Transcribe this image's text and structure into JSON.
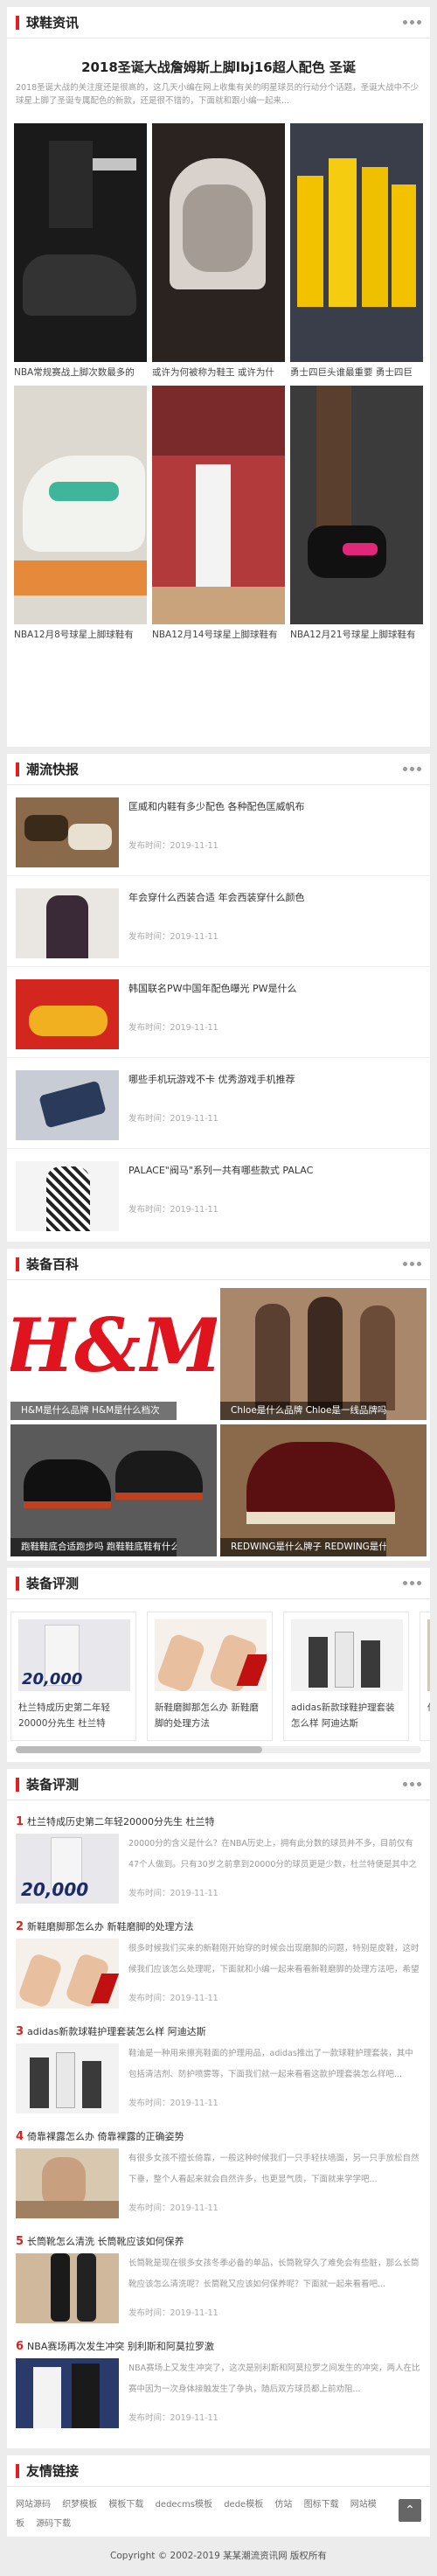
{
  "section1": {
    "title": "球鞋资讯",
    "headline": "2018圣诞大战詹姆斯上脚lbj16超人配色 圣诞",
    "lead": "2018圣诞大战的关注度还是很高的，这几天小编在网上收集有关的明星球员的行动分个话题，圣诞大战中不少球星上脚了圣诞专属配色的新款，还是很不错的，下面就和跟小编一起来...",
    "items": [
      {
        "caption": "NBA常规赛战上脚次数最多的"
      },
      {
        "caption": "或许为何被称为鞋王 或许为什"
      },
      {
        "caption": "勇士四巨头谁最重要 勇士四巨"
      },
      {
        "caption": "NBA12月8号球星上脚球鞋有"
      },
      {
        "caption": "NBA12月14号球星上脚球鞋有"
      },
      {
        "caption": "NBA12月21号球星上脚球鞋有"
      }
    ]
  },
  "section2": {
    "title": "潮流快报",
    "date_label": "发布时间：",
    "items": [
      {
        "title": "匡威和内鞋有多少配色 各种配色匡威帆布",
        "date": "2019-11-11"
      },
      {
        "title": "年会穿什么西装合适 年会西装穿什么颜色",
        "date": "2019-11-11"
      },
      {
        "title": "韩国联名PW中国年配色曝光 PW是什么",
        "date": "2019-11-11"
      },
      {
        "title": "哪些手机玩游戏不卡 优秀游戏手机推荐",
        "date": "2019-11-11"
      },
      {
        "title": "PALACE\"阀马\"系列一共有哪些款式 PALAC",
        "date": "2019-11-11"
      }
    ]
  },
  "section3": {
    "title": "装备百科",
    "items": [
      {
        "caption": "H&M是什么品牌 H&M是什么档次"
      },
      {
        "caption": "Chloe是什么品牌 Chloe是一线品牌吗"
      },
      {
        "caption": "跑鞋鞋底合适跑步吗 跑鞋鞋底鞋有什么特"
      },
      {
        "caption": "REDWING是什么牌子 REDWING是什么"
      }
    ]
  },
  "section4": {
    "title": "装备评测",
    "items": [
      {
        "caption": "杜兰特成历史第二年轻20000分先生 杜兰特"
      },
      {
        "caption": "新鞋磨脚那怎么办 新鞋磨脚的处理方法"
      },
      {
        "caption": "adidas新款球鞋护理套装怎么样 阿迪达斯"
      },
      {
        "caption": "倚"
      }
    ]
  },
  "section5": {
    "title": "装备评测",
    "date_label": "发布时间：",
    "items": [
      {
        "num": "1",
        "title": "杜兰特成历史第二年轻20000分先生 杜兰特",
        "desc": "20000分的含义是什么？在NBA历史上，拥有此分数的球员并不多，目前仅有47个人做到。只有30岁之前拿到20000分的球员更是少数，杜兰特便是其中之一...",
        "date": "2019-11-11"
      },
      {
        "num": "2",
        "title": "新鞋磨脚那怎么办 新鞋磨脚的处理方法",
        "desc": "很多时候我们买来的新鞋刚开始穿的时候会出现磨脚的问题，特别是皮鞋，这时候我们应该怎么处理呢，下面就和小编一起来看看新鞋磨脚的处理方法吧，希望对你有所帮助...",
        "date": "2019-11-11"
      },
      {
        "num": "3",
        "title": "adidas新款球鞋护理套装怎么样 阿迪达斯",
        "desc": "鞋油是一种用来擦亮鞋面的护理用品，adidas推出了一款球鞋护理套装，其中包括清洁剂、防护喷雾等，下面我们就一起来看看这款护理套装怎么样吧...",
        "date": "2019-11-11"
      },
      {
        "num": "4",
        "title": "倚靠裸露怎么办 倚靠裸露的正确姿势",
        "desc": "有很多女孩不擅长倚靠，一般这种时候我们一只手轻扶墙面，另一只手放松自然下垂，整个人看起来就会自然许多，也更显气质，下面就来学学吧...",
        "date": "2019-11-11"
      },
      {
        "num": "5",
        "title": "长筒靴怎么清洗 长筒靴应该如何保养",
        "desc": "长筒靴是现在很多女孩冬季必备的单品，长筒靴穿久了难免会有些脏，那么长筒靴应该怎么清洗呢？长筒靴又应该如何保养呢？下面就一起来看看吧...",
        "date": "2019-11-11"
      },
      {
        "num": "6",
        "title": "NBA赛场再次发生冲突 别利斯和阿莫拉罗激",
        "desc": "NBA赛场上又发生冲突了，这次是别利斯和阿莫拉罗之间发生的冲突，两人在比赛中因为一次身体接触发生了争执，随后双方球员都上前劝阻...",
        "date": "2019-11-11"
      }
    ]
  },
  "links": {
    "title": "友情链接",
    "items": [
      "网站源码",
      "织梦模板",
      "模板下载",
      "dedecms模板",
      "dede模板",
      "仿站",
      "图标下载",
      "网站模板",
      "源码下载"
    ],
    "totop": "⌃"
  },
  "footer": "Copyright © 2002-2019 某某潮流资讯网 版权所有"
}
